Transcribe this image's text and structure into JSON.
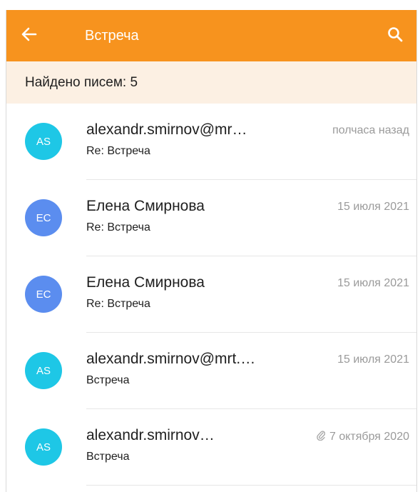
{
  "appbar": {
    "title": "Встреча",
    "background": "#f7931e",
    "back_icon": "arrow-left-icon",
    "search_icon": "search-icon"
  },
  "results": {
    "found_label": "Найдено писем: 5"
  },
  "colors": {
    "avatar_as": "#1ec7e6",
    "avatar_ec": "#5b8def"
  },
  "emails": [
    {
      "initials": "AS",
      "avatar_color": "#1ec7e6",
      "sender": "alexandr.smirnov@mr…",
      "subject": "Re: Встреча",
      "date": "полчаса назад",
      "attachment": false
    },
    {
      "initials": "EC",
      "avatar_color": "#5b8def",
      "sender": "Елена Смирнова",
      "subject": "Re: Встреча",
      "date": "15 июля 2021",
      "attachment": false
    },
    {
      "initials": "EC",
      "avatar_color": "#5b8def",
      "sender": "Елена Смирнова",
      "subject": "Re: Встреча",
      "date": "15 июля 2021",
      "attachment": false
    },
    {
      "initials": "AS",
      "avatar_color": "#1ec7e6",
      "sender": "alexandr.smirnov@mrt.…",
      "subject": "Встреча",
      "date": "15 июля 2021",
      "attachment": false
    },
    {
      "initials": "AS",
      "avatar_color": "#1ec7e6",
      "sender": "alexandr.smirnov…",
      "subject": "Встреча",
      "date": "7 октября 2020",
      "attachment": true
    }
  ]
}
